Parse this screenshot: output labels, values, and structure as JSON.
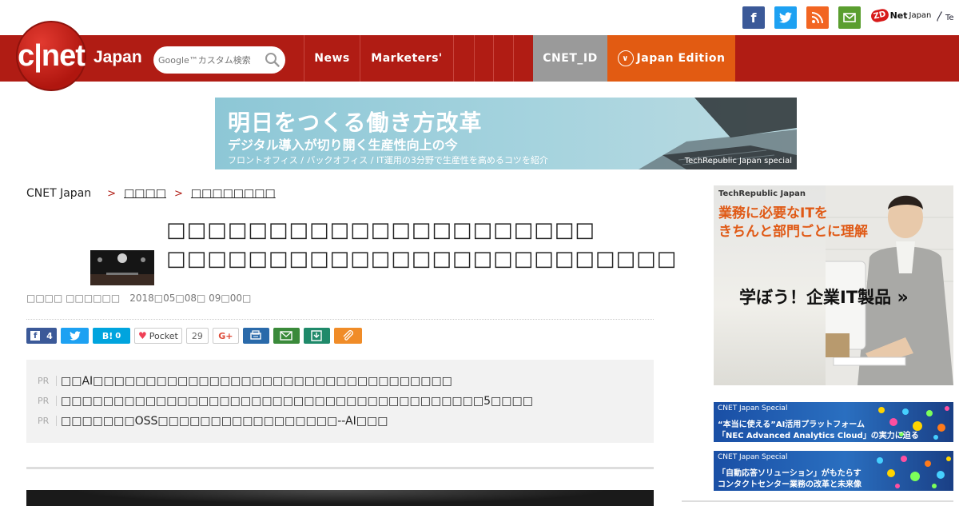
{
  "header": {
    "social": [
      {
        "name": "facebook",
        "glyph": "f",
        "color": "#3b5998"
      },
      {
        "name": "twitter",
        "glyph": "t",
        "color": "#1da1f2"
      },
      {
        "name": "rss",
        "glyph": "◉",
        "color": "#f26522"
      },
      {
        "name": "mail",
        "glyph": "✉",
        "color": "#5a9e2f"
      }
    ],
    "zdnet_logo": "ZD",
    "zdnet_text": "Net",
    "zdnet_japan": "Japan",
    "techrepublic_mark": "Te"
  },
  "nav": {
    "logo": "c|net",
    "japan": "Japan",
    "search_placeholder": "Google™カスタム検索",
    "links": [
      "News",
      "Marketers'"
    ],
    "cnet_id": "CNET_ID",
    "edition": "Japan Edition",
    "colors": {
      "bar": "#b01c14",
      "cnet_id": "#9a9a9a",
      "edition": "#e25b12"
    }
  },
  "banner": {
    "line1": "明日をつくる働き方改革",
    "line2": "デジタル導入が切り開く生産性向上の今",
    "line3": "フロントオフィス / バックオフィス / IT運用の3分野で生産性を高めるコツを紹介",
    "sponsor": "TechRepublic Japan special"
  },
  "breadcrumb": {
    "home": "CNET Japan",
    "sep": ">",
    "level1": "□□□□",
    "level2": "□□□□□□□□"
  },
  "article": {
    "title": "□□□□□□□□□□□□□□□□□□□□□ □□□□□□□□□□□□□□□□□□□□□□□□□",
    "author": "□□□□ □□□□□□",
    "date": "2018□05□08□ 09□00□"
  },
  "share": {
    "facebook_count": "4",
    "hatena_label": "B!",
    "hatena_count": "0",
    "pocket_label": "Pocket",
    "pocket_count": "29",
    "gplus": "G+"
  },
  "pr": {
    "tag": "PR",
    "items": [
      "□□AI□□□□□□□□□□□□□□□□□□□□□□□□□□□□□□□□□□",
      "□□□□□□□□□□□□□□□□□□□□□□□□□□□□□□□□□□□□□□□□5□□□□",
      "□□□□□□□OSS□□□□□□□□□□□□□□□□□--AI□□□"
    ]
  },
  "sidebar": {
    "ad1": {
      "header": "TechRepublic Japan",
      "line1": "業務に必要なITを",
      "line2": "きちんと部門ごとに理解",
      "cta": "学ぼう！企業IT製品",
      "caret": "»"
    },
    "ad2": {
      "header": "CNET Japan Special",
      "line1": "“本当に使える”AI活用プラットフォーム",
      "line2": "「NEC Advanced Analytics Cloud」の実力に迫る"
    },
    "ad3": {
      "header": "CNET Japan Special",
      "line1": "「自動応答ソリューション」がもたらす",
      "line2": "コンタクトセンター業務の改革と未来像"
    }
  }
}
